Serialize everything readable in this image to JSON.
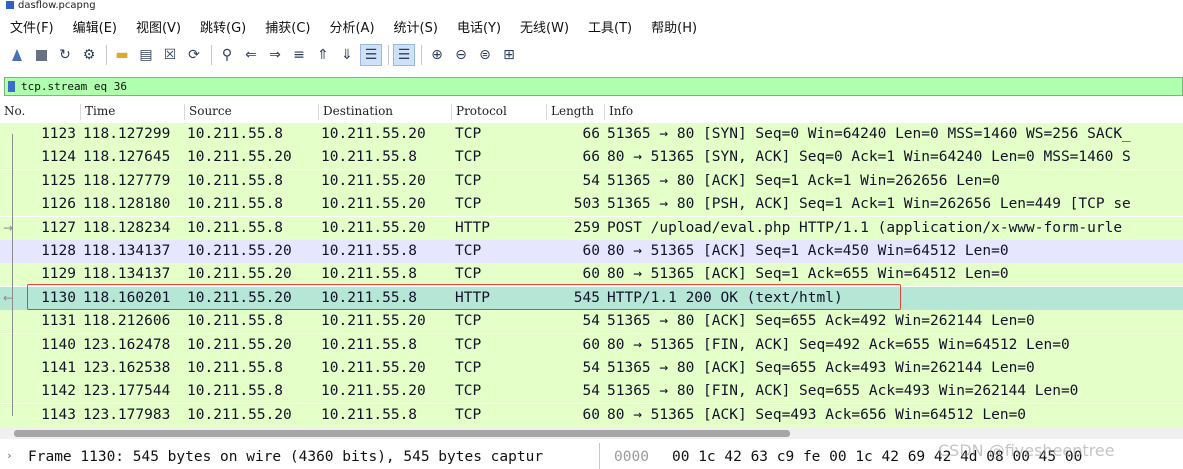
{
  "window": {
    "title": "dasflow.pcapng"
  },
  "menu": [
    "文件(F)",
    "编辑(E)",
    "视图(V)",
    "跳转(G)",
    "捕获(C)",
    "分析(A)",
    "统计(S)",
    "电话(Y)",
    "无线(W)",
    "工具(T)",
    "帮助(H)"
  ],
  "filter": {
    "value": "tcp.stream eq 36"
  },
  "columns": {
    "no": "No.",
    "time": "Time",
    "source": "Source",
    "destination": "Destination",
    "protocol": "Protocol",
    "length": "Length",
    "info": "Info"
  },
  "packets": [
    {
      "no": "1123",
      "time": "118.127299",
      "src": "10.211.55.8",
      "dst": "10.211.55.20",
      "proto": "TCP",
      "len": "66",
      "info": "51365 → 80 [SYN] Seq=0 Win=64240 Len=0 MSS=1460 WS=256 SACK_"
    },
    {
      "no": "1124",
      "time": "118.127645",
      "src": "10.211.55.20",
      "dst": "10.211.55.8",
      "proto": "TCP",
      "len": "66",
      "info": "80 → 51365 [SYN, ACK] Seq=0 Ack=1 Win=64240 Len=0 MSS=1460 S"
    },
    {
      "no": "1125",
      "time": "118.127779",
      "src": "10.211.55.8",
      "dst": "10.211.55.20",
      "proto": "TCP",
      "len": "54",
      "info": "51365 → 80 [ACK] Seq=1 Ack=1 Win=262656 Len=0"
    },
    {
      "no": "1126",
      "time": "118.128180",
      "src": "10.211.55.8",
      "dst": "10.211.55.20",
      "proto": "TCP",
      "len": "503",
      "info": "51365 → 80 [PSH, ACK] Seq=1 Ack=1 Win=262656 Len=449 [TCP se"
    },
    {
      "no": "1127",
      "time": "118.128234",
      "src": "10.211.55.8",
      "dst": "10.211.55.20",
      "proto": "HTTP",
      "len": "259",
      "info": "POST /upload/eval.php HTTP/1.1  (application/x-www-form-urle"
    },
    {
      "no": "1128",
      "time": "118.134137",
      "src": "10.211.55.20",
      "dst": "10.211.55.8",
      "proto": "TCP",
      "len": "60",
      "info": "80 → 51365 [ACK] Seq=1 Ack=450 Win=64512 Len=0"
    },
    {
      "no": "1129",
      "time": "118.134137",
      "src": "10.211.55.20",
      "dst": "10.211.55.8",
      "proto": "TCP",
      "len": "60",
      "info": "80 → 51365 [ACK] Seq=1 Ack=655 Win=64512 Len=0"
    },
    {
      "no": "1130",
      "time": "118.160201",
      "src": "10.211.55.20",
      "dst": "10.211.55.8",
      "proto": "HTTP",
      "len": "545",
      "info": "HTTP/1.1 200 OK  (text/html)"
    },
    {
      "no": "1131",
      "time": "118.212606",
      "src": "10.211.55.8",
      "dst": "10.211.55.20",
      "proto": "TCP",
      "len": "54",
      "info": "51365 → 80 [ACK] Seq=655 Ack=492 Win=262144 Len=0"
    },
    {
      "no": "1140",
      "time": "123.162478",
      "src": "10.211.55.20",
      "dst": "10.211.55.8",
      "proto": "TCP",
      "len": "60",
      "info": "80 → 51365 [FIN, ACK] Seq=492 Ack=655 Win=64512 Len=0"
    },
    {
      "no": "1141",
      "time": "123.162538",
      "src": "10.211.55.8",
      "dst": "10.211.55.20",
      "proto": "TCP",
      "len": "54",
      "info": "51365 → 80 [ACK] Seq=655 Ack=493 Win=262144 Len=0"
    },
    {
      "no": "1142",
      "time": "123.177544",
      "src": "10.211.55.8",
      "dst": "10.211.55.20",
      "proto": "TCP",
      "len": "54",
      "info": "51365 → 80 [FIN, ACK] Seq=655 Ack=493 Win=262144 Len=0"
    },
    {
      "no": "1143",
      "time": "123.177983",
      "src": "10.211.55.20",
      "dst": "10.211.55.8",
      "proto": "TCP",
      "len": "60",
      "info": "80 → 51365 [ACK] Seq=493 Ack=656 Win=64512 Len=0"
    }
  ],
  "selected_no": "1130",
  "detail": {
    "frame": "Frame 1130: 545 bytes on wire (4360 bits), 545 bytes captur"
  },
  "bytes": {
    "offset": "0000",
    "hex": "00 1c 42 63 c9 fe 00 1c  42 69 42 4d 08 00 45 00"
  },
  "watermark": "CSDN @fivesheeptree"
}
